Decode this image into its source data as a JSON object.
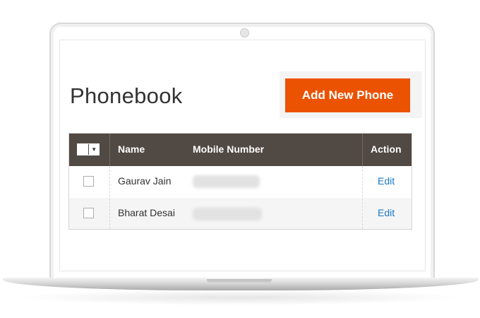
{
  "page": {
    "title": "Phonebook"
  },
  "toolbar": {
    "add_button_label": "Add New Phone"
  },
  "grid": {
    "columns": {
      "name": "Name",
      "mobile": "Mobile Number",
      "action": "Action"
    },
    "rows": [
      {
        "name": "Gaurav Jain",
        "action": "Edit"
      },
      {
        "name": "Bharat Desai",
        "action": "Edit"
      }
    ]
  },
  "colors": {
    "accent": "#eb5202",
    "header_bg": "#514943",
    "link": "#1979c3"
  }
}
